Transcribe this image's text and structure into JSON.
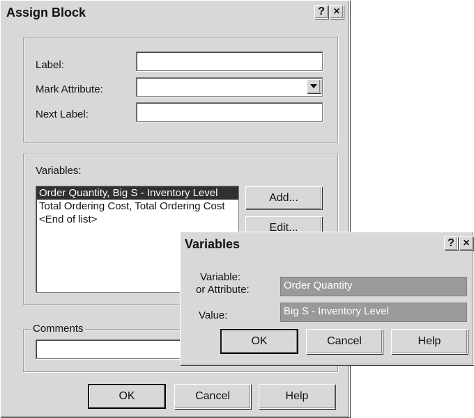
{
  "assign_block": {
    "title": "Assign Block",
    "help_btn": "?",
    "close_btn": "×",
    "label_caption": "Label:",
    "label_value": "",
    "mark_attribute_caption": "Mark Attribute:",
    "mark_attribute_value": "",
    "next_label_caption": "Next Label:",
    "next_label_value": "",
    "variables_caption": "Variables:",
    "variables_items": [
      "Order Quantity, Big S - Inventory Level",
      "Total Ordering Cost, Total Ordering Cost",
      "<End of list>"
    ],
    "add_button": "Add...",
    "edit_button": "Edit...",
    "comments_caption": "Comments",
    "comments_value": "",
    "ok_button": "OK",
    "cancel_button": "Cancel",
    "help_button": "Help"
  },
  "variables_dialog": {
    "title": "Variables",
    "help_btn": "?",
    "close_btn": "×",
    "variable_caption_line1": "Variable:",
    "variable_caption_line2": "or Attribute:",
    "variable_value": "Order Quantity",
    "value_caption": "Value:",
    "value_value": "Big S - Inventory Level",
    "ok_button": "OK",
    "cancel_button": "Cancel",
    "help_button": "Help"
  }
}
